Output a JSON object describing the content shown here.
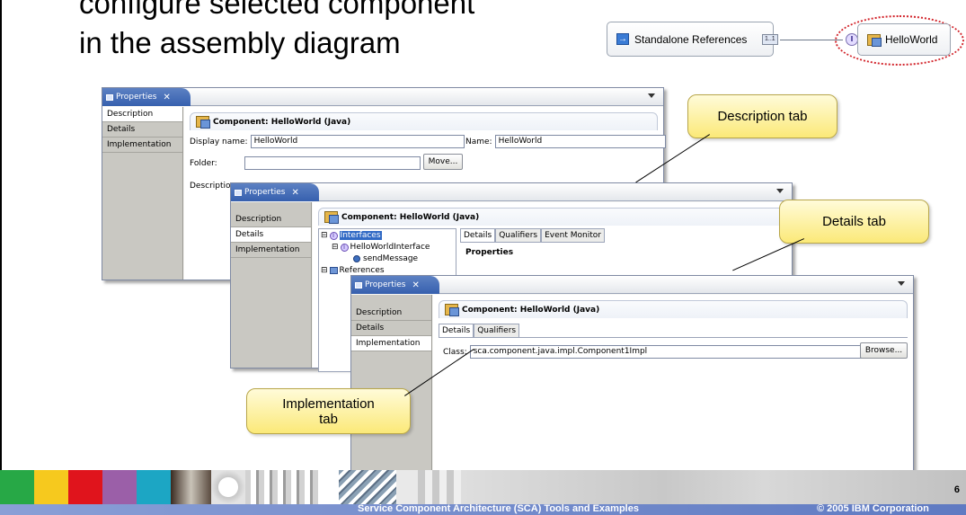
{
  "slide": {
    "title_line1": "configure selected component",
    "title_line2": "in the assembly diagram"
  },
  "diagram": {
    "standalone_label": "Standalone References",
    "multiplicity": "1..1",
    "component_label": "HelloWorld",
    "highlight_color": "#d2232a"
  },
  "window1": {
    "tab_label": "Properties",
    "sidebar": [
      "Description",
      "Details",
      "Implementation"
    ],
    "header": "Component: HelloWorld (Java)",
    "display_name_label": "Display name:",
    "display_name_value": "HelloWorld",
    "name_label": "Name:",
    "name_value": "HelloWorld",
    "folder_label": "Folder:",
    "folder_value": "",
    "move_button": "Move...",
    "description_label": "Descriptio"
  },
  "window2": {
    "tab_label": "Properties",
    "sidebar": [
      "Description",
      "Details",
      "Implementation"
    ],
    "header": "Component: HelloWorld (Java)",
    "tree": [
      "Interfaces",
      "HelloWorldInterface",
      "sendMessage",
      "References"
    ],
    "subtabs": [
      "Details",
      "Qualifiers",
      "Event Monitor"
    ],
    "section_title": "Properties"
  },
  "window3": {
    "tab_label": "Properties",
    "sidebar": [
      "Description",
      "Details",
      "Implementation"
    ],
    "header": "Component: HelloWorld (Java)",
    "subtabs": [
      "Details",
      "Qualifiers"
    ],
    "class_label": "Class:",
    "class_value": "sca.component.java.impl.Component1Impl",
    "browse_button": "Browse..."
  },
  "callouts": {
    "description": "Description tab",
    "details": "Details tab",
    "implementation_line1": "Implementation",
    "implementation_line2": "tab"
  },
  "footer": {
    "center_text": "Service Component Architecture (SCA) Tools and Examples",
    "copyright": "© 2005 IBM Corporation",
    "page_number": "6",
    "brand_colors": [
      "#27a846",
      "#f6c91e",
      "#e0141c",
      "#9b5fa8",
      "#1ca6c4"
    ]
  }
}
